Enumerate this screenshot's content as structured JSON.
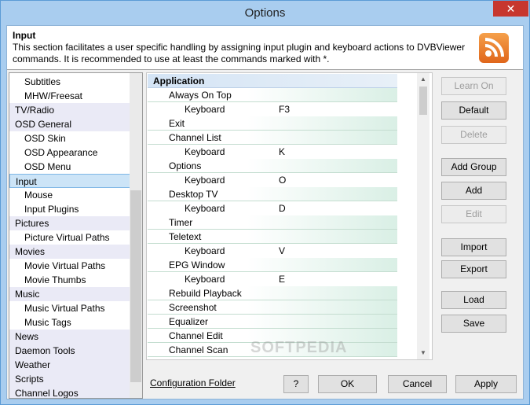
{
  "window": {
    "title": "Options",
    "close_glyph": "✕"
  },
  "header": {
    "title": "Input",
    "description": "This section facilitates a user specific handling by assigning input plugin and keyboard actions to DVBViewer commands. It is recommended to use at least the commands marked with *.",
    "icon": "rss-feed-icon"
  },
  "tree": {
    "items": [
      {
        "label": "Subtitles",
        "indent": 1
      },
      {
        "label": "MHW/Freesat",
        "indent": 1
      },
      {
        "label": "TV/Radio",
        "indent": 0
      },
      {
        "label": "OSD General",
        "indent": 0
      },
      {
        "label": "OSD Skin",
        "indent": 1
      },
      {
        "label": "OSD Appearance",
        "indent": 1
      },
      {
        "label": "OSD Menu",
        "indent": 1
      },
      {
        "label": "Input",
        "indent": 0,
        "selected": true
      },
      {
        "label": "Mouse",
        "indent": 1
      },
      {
        "label": "Input Plugins",
        "indent": 1
      },
      {
        "label": "Pictures",
        "indent": 0
      },
      {
        "label": "Picture Virtual Paths",
        "indent": 1
      },
      {
        "label": "Movies",
        "indent": 0
      },
      {
        "label": "Movie Virtual Paths",
        "indent": 1
      },
      {
        "label": "Movie Thumbs",
        "indent": 1
      },
      {
        "label": "Music",
        "indent": 0
      },
      {
        "label": "Music Virtual Paths",
        "indent": 1
      },
      {
        "label": "Music Tags",
        "indent": 1
      },
      {
        "label": "News",
        "indent": 0
      },
      {
        "label": "Daemon Tools",
        "indent": 0
      },
      {
        "label": "Weather",
        "indent": 0
      },
      {
        "label": "Scripts",
        "indent": 0
      },
      {
        "label": "Channel Logos",
        "indent": 0
      }
    ]
  },
  "commands": {
    "rows": [
      {
        "type": "group",
        "label": "Application"
      },
      {
        "type": "action",
        "label": "Always On Top"
      },
      {
        "type": "key",
        "label": "Keyboard",
        "value": "F3"
      },
      {
        "type": "action",
        "label": "Exit"
      },
      {
        "type": "action",
        "label": "Channel List"
      },
      {
        "type": "key",
        "label": "Keyboard",
        "value": "K"
      },
      {
        "type": "action",
        "label": "Options"
      },
      {
        "type": "key",
        "label": "Keyboard",
        "value": "O"
      },
      {
        "type": "action",
        "label": "Desktop TV"
      },
      {
        "type": "key",
        "label": "Keyboard",
        "value": "D"
      },
      {
        "type": "action",
        "label": "Timer"
      },
      {
        "type": "action",
        "label": "Teletext"
      },
      {
        "type": "key",
        "label": "Keyboard",
        "value": "V"
      },
      {
        "type": "action",
        "label": "EPG Window"
      },
      {
        "type": "key",
        "label": "Keyboard",
        "value": "E"
      },
      {
        "type": "action",
        "label": "Rebuild Playback"
      },
      {
        "type": "action",
        "label": "Screenshot"
      },
      {
        "type": "action",
        "label": "Equalizer"
      },
      {
        "type": "action",
        "label": "Channel Edit"
      },
      {
        "type": "action",
        "label": "Channel Scan"
      }
    ]
  },
  "buttons": {
    "learn_on": "Learn On",
    "default": "Default",
    "delete": "Delete",
    "add_group": "Add Group",
    "add": "Add",
    "edit": "Edit",
    "import": "Import",
    "export": "Export",
    "load": "Load",
    "save": "Save",
    "help": "?",
    "ok": "OK",
    "cancel": "Cancel",
    "apply": "Apply"
  },
  "footer": {
    "link": "Configuration Folder"
  },
  "watermark": "SOFTPEDIA"
}
